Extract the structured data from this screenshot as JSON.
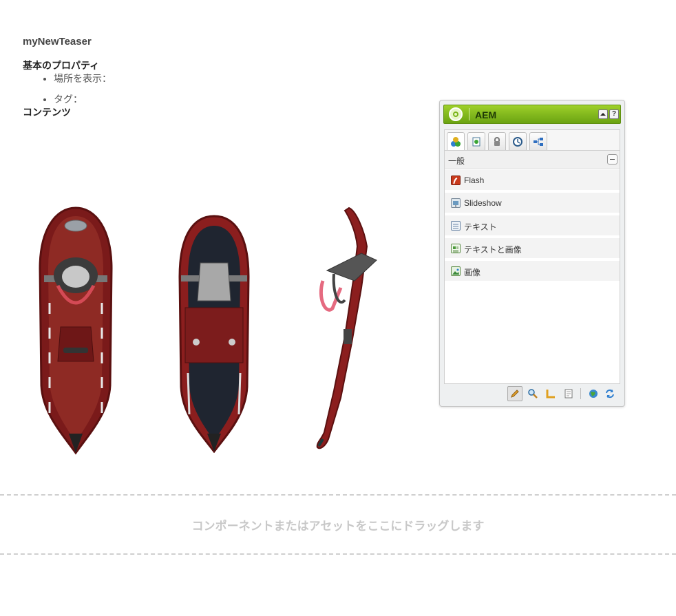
{
  "page": {
    "title": "myNewTeaser",
    "properties_heading": "基本のプロパティ",
    "properties": [
      {
        "label": "場所を表示："
      },
      {
        "label": "タグ："
      }
    ],
    "content_heading": "コンテンツ"
  },
  "drop_zone": {
    "text": "コンポーネントまたはアセットをここにドラッグします"
  },
  "sidekick": {
    "title": "AEM",
    "header_icons": [
      "collapse-up-icon",
      "help-icon"
    ],
    "help_label": "?",
    "tabs": [
      {
        "name": "components-tab",
        "icon": "components-icon"
      },
      {
        "name": "page-tab",
        "icon": "page-icon"
      },
      {
        "name": "lock-tab",
        "icon": "lock-icon"
      },
      {
        "name": "versioning-tab",
        "icon": "clock-icon"
      },
      {
        "name": "workflow-tab",
        "icon": "workflow-icon"
      }
    ],
    "group": {
      "label": "一般"
    },
    "components": [
      {
        "label": "Flash",
        "icon": "flash-icon"
      },
      {
        "label": "Slideshow",
        "icon": "slideshow-icon"
      },
      {
        "label": "テキスト",
        "icon": "text-icon"
      },
      {
        "label": "テキストと画像",
        "icon": "text-image-icon"
      },
      {
        "label": "画像",
        "icon": "image-icon"
      }
    ],
    "footer_tools": [
      "edit-pencil-icon",
      "preview-magnifier-icon",
      "design-ruler-icon",
      "page-properties-icon",
      "publish-globe-icon",
      "refresh-icon"
    ]
  },
  "colors": {
    "sidekick_green": "#7bb51a",
    "snowshoe_red": "#8b1e1e"
  }
}
